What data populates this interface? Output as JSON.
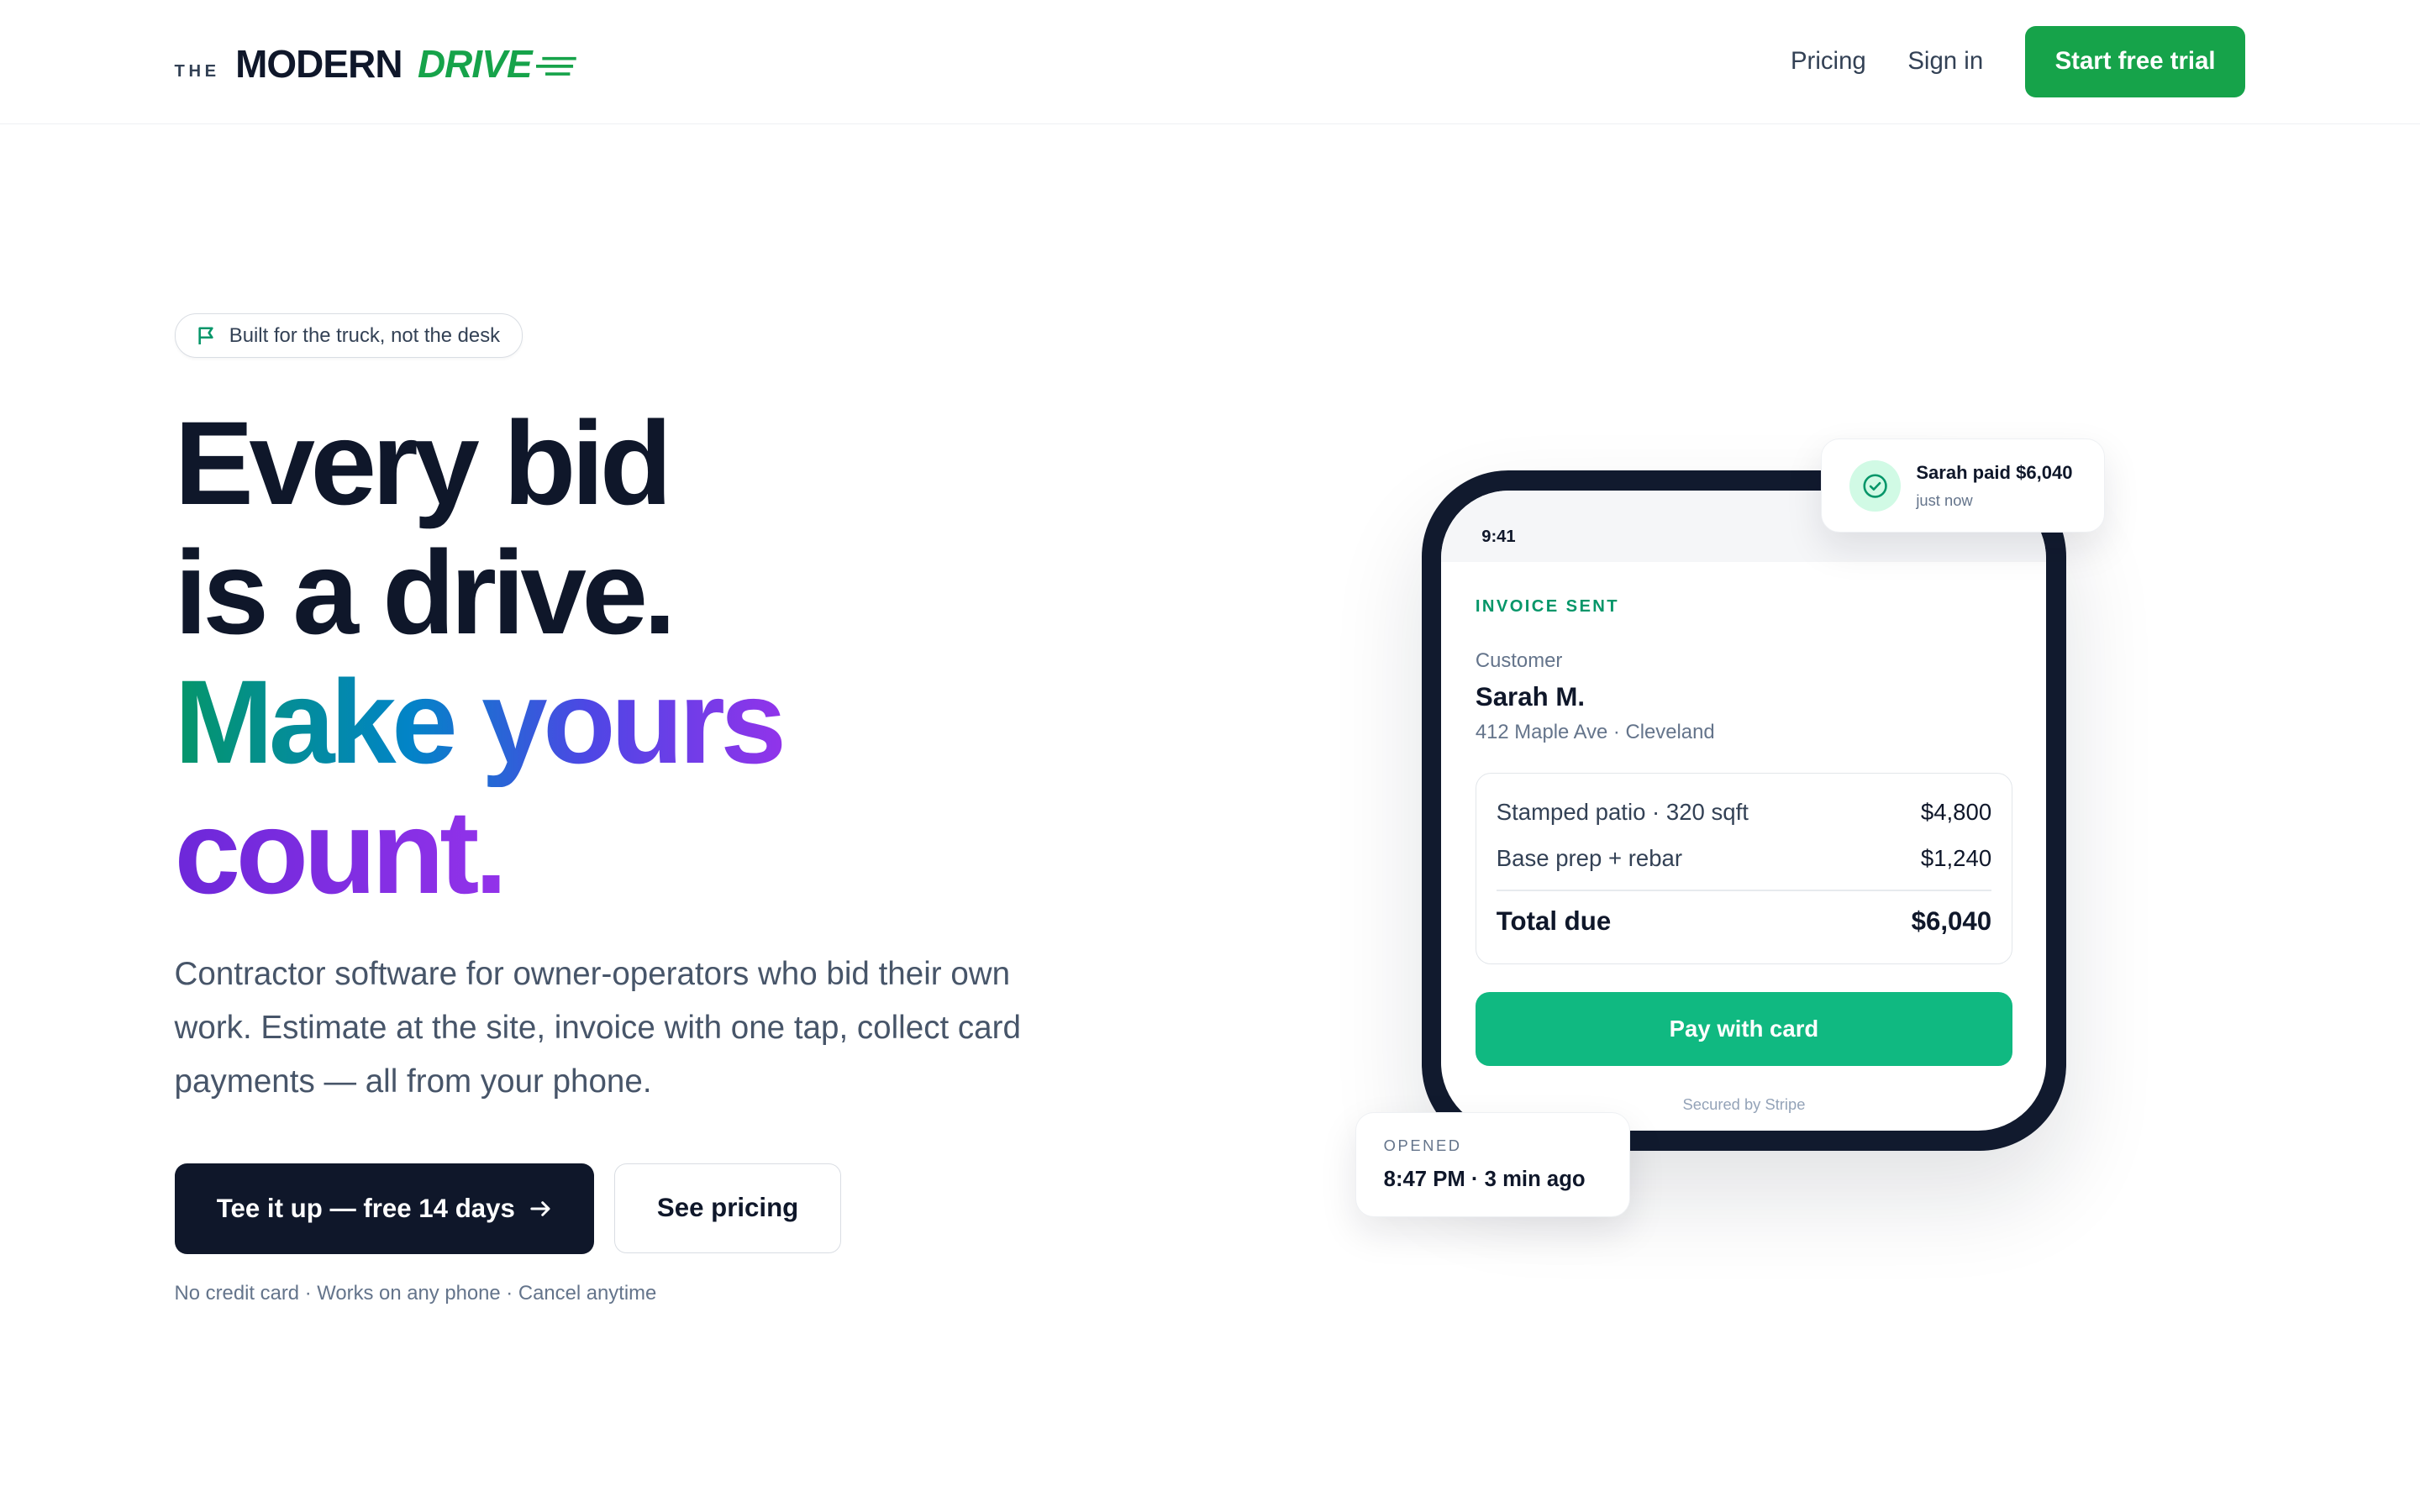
{
  "header": {
    "logo": {
      "the": "THE",
      "modern": "MODERN",
      "drive": "DRIVE"
    },
    "nav": {
      "pricing": "Pricing",
      "sign_in": "Sign in",
      "cta": "Start free trial"
    }
  },
  "hero": {
    "badge": "Built for the truck, not the desk",
    "headline": {
      "line1": "Every bid",
      "line2": "is a drive.",
      "line3": "Make yours",
      "line4": "count."
    },
    "lead": "Contractor software for owner-operators who bid their own work. Estimate at the site, invoice with one tap, collect card payments — all from your phone.",
    "primary_cta": "Tee it up — free 14 days",
    "secondary_cta": "See pricing",
    "fine_print": "No credit card · Works on any phone · Cancel anytime"
  },
  "phone": {
    "time": "9:41",
    "invoice_status": "INVOICE SENT",
    "customer_label": "Customer",
    "customer_name": "Sarah M.",
    "customer_address": "412 Maple Ave · Cleveland",
    "items": [
      {
        "label": "Stamped patio · 320 sqft",
        "price": "$4,800"
      },
      {
        "label": "Base prep + rebar",
        "price": "$1,240"
      }
    ],
    "total_label": "Total due",
    "total_value": "$6,040",
    "pay_button": "Pay with card",
    "secured": "Secured by Stripe"
  },
  "notification": {
    "title": "Sarah paid $6,040",
    "subtitle": "just now"
  },
  "opened_card": {
    "label": "OPENED",
    "value": "8:47 PM · 3 min ago"
  },
  "colors": {
    "brand_green": "#16a34a",
    "pay_green": "#10b981",
    "dark": "#0f172a"
  }
}
